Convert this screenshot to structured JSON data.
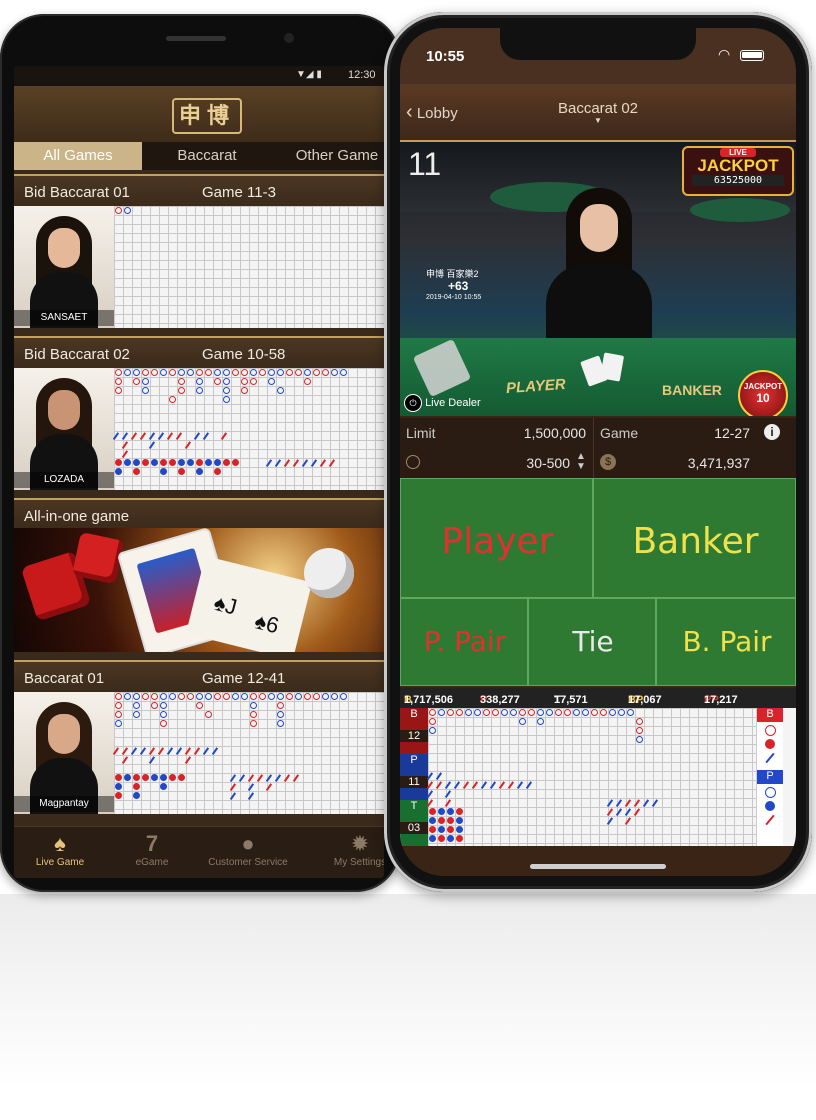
{
  "android": {
    "status_time": "12:30",
    "logo_text": "申博",
    "tabs": [
      {
        "label": "All Games",
        "active": true
      },
      {
        "label": "Baccarat",
        "active": false
      },
      {
        "label": "Other Game",
        "active": false
      }
    ],
    "tables": [
      {
        "name": "Bid Baccarat 01",
        "game": "Game 11-3",
        "dealer": "SANSAET"
      },
      {
        "name": "Bid Baccarat 02",
        "game": "Game 10-58",
        "dealer": "LOZADA"
      },
      {
        "name": "All-in-one game"
      },
      {
        "name": "Baccarat 01",
        "game": "Game 12-41",
        "dealer": "Magpantay"
      }
    ],
    "bottom_nav": [
      {
        "label": "Live Game",
        "icon": "spade-icon",
        "active": true
      },
      {
        "label": "eGame",
        "icon": "seven-icon",
        "active": false
      },
      {
        "label": "Customer Service",
        "icon": "chat-icon",
        "active": false
      },
      {
        "label": "My Settings",
        "icon": "gear-icon",
        "active": false
      }
    ]
  },
  "iphone": {
    "status_time": "10:55",
    "back_label": "Lobby",
    "title": "Baccarat 02",
    "video": {
      "round_number": "11",
      "jackpot_title": "LIVE",
      "jackpot_label": "JACKPOT",
      "jackpot_value": "63525000",
      "live_dealer_label": "Live Dealer",
      "jackpot_badge_label": "JACKPOT",
      "jackpot_badge_value": "10",
      "table_text": "申博 百家樂2",
      "table_plus": "+63",
      "table_date": "2019-04-10 10:55",
      "felt_player": "PLAYER",
      "felt_banker": "BANKER"
    },
    "limit_label": "Limit",
    "limit_value": "1,500,000",
    "game_label": "Game",
    "game_value": "12-27",
    "bet_range": "30-500",
    "balance": "3,471,937",
    "bets": {
      "player": "Player",
      "banker": "Banker",
      "p_pair": "P. Pair",
      "tie": "Tie",
      "b_pair": "B. Pair"
    },
    "stats": {
      "b_label": "B",
      "b_value": "1,717,506",
      "p_label": "P",
      "p_value": "338,277",
      "t_label": "T",
      "t_value": "17,571",
      "bp_label": "BP",
      "bp_value": "17,067",
      "pp_label": "PP",
      "pp_value": "17,217"
    },
    "road_counts": {
      "b_label": "B",
      "b_value": "12",
      "p_label": "P",
      "p_value": "11",
      "t_label": "T",
      "t_value": "03"
    },
    "predict": {
      "b_label": "B",
      "p_label": "P"
    }
  },
  "colors": {
    "banker_red": "#d8232a",
    "player_blue": "#2048c8",
    "felt_green": "#2e7a33",
    "gold_accent": "#c59b5b"
  }
}
